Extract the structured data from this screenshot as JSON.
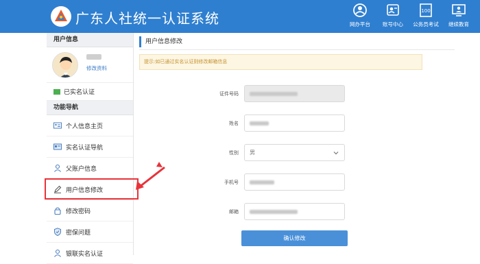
{
  "app": {
    "title": "广东人社统一认证系统"
  },
  "topnav": [
    {
      "label": "网办平台",
      "icon": "gear-person-icon"
    },
    {
      "label": "账号中心",
      "icon": "id-card-icon"
    },
    {
      "label": "公务员考试",
      "icon": "exam-paper-icon"
    },
    {
      "label": "继续教育",
      "icon": "monitor-person-icon"
    }
  ],
  "sidebar": {
    "user_info_title": "用户信息",
    "edit_profile_link": "修改资料",
    "verified_label": "已实名认证",
    "nav_title": "功能导航",
    "items": [
      {
        "label": "个人信息主页",
        "icon": "profile-card-icon"
      },
      {
        "label": "实名认证导航",
        "icon": "id-badge-icon"
      },
      {
        "label": "父账户信息",
        "icon": "person-icon"
      },
      {
        "label": "用户信息修改",
        "icon": "pencil-icon"
      },
      {
        "label": "修改密码",
        "icon": "lock-icon"
      },
      {
        "label": "密保问题",
        "icon": "shield-icon"
      },
      {
        "label": "银联实名认证",
        "icon": "person-icon"
      }
    ]
  },
  "main": {
    "breadcrumb": "用户信息修改",
    "notice": "提示:如已通过实名认证则修改邮箱信息",
    "fields": [
      {
        "label": "证件号码",
        "value": ""
      },
      {
        "label": "姓名",
        "value": ""
      },
      {
        "label": "性别",
        "value": "男"
      },
      {
        "label": "手机号",
        "value": ""
      },
      {
        "label": "邮箱",
        "value": ""
      }
    ],
    "confirm_label": "确认修改"
  },
  "colors": {
    "header": "#2f7fd0",
    "accent": "#4a90d9",
    "highlight": "#e8323a",
    "notice_text": "#c8922e"
  }
}
